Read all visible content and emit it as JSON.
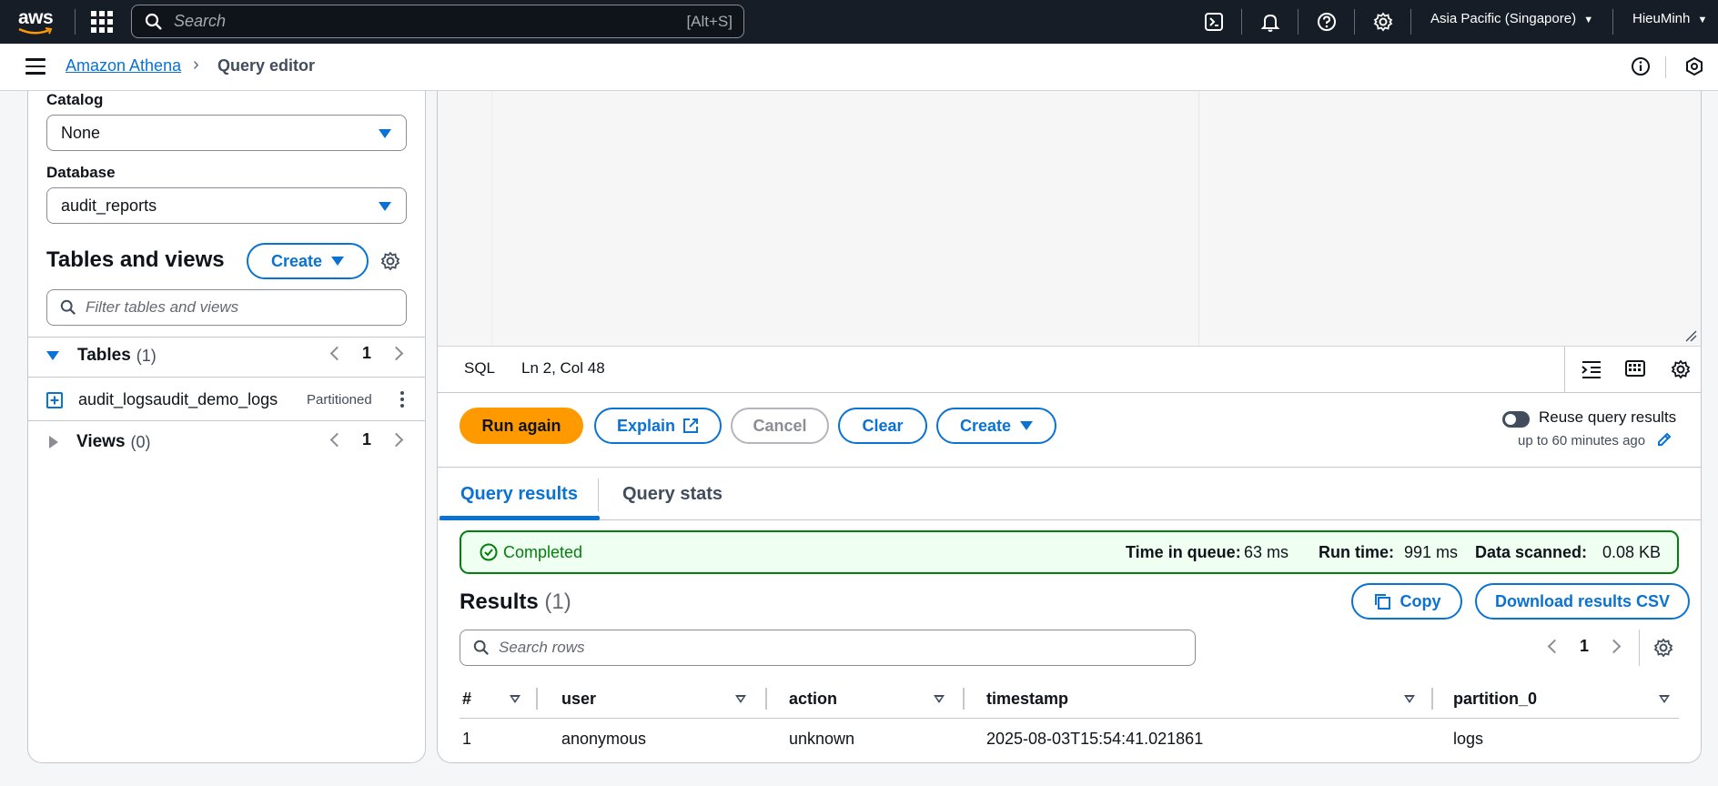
{
  "topbar": {
    "logo": "aws",
    "search_placeholder": "Search",
    "search_shortcut": "[Alt+S]",
    "region": "Asia Pacific (Singapore)",
    "user": "HieuMinh"
  },
  "breadcrumb": {
    "parent": "Amazon Athena",
    "current": "Query editor"
  },
  "left": {
    "catalog_label": "Catalog",
    "catalog_value": "None",
    "database_label": "Database",
    "database_value": "audit_reports",
    "tables_views_title": "Tables and views",
    "create_label": "Create",
    "filter_placeholder": "Filter tables and views",
    "tables": {
      "label": "Tables",
      "count": "(1)",
      "page": "1",
      "items": [
        {
          "name": "audit_logsaudit_demo_logs",
          "badge": "Partitioned"
        }
      ]
    },
    "views": {
      "label": "Views",
      "count": "(0)",
      "page": "1"
    }
  },
  "editor": {
    "language": "SQL",
    "cursor": "Ln 2, Col 48"
  },
  "actions": {
    "run_again": "Run again",
    "explain": "Explain",
    "cancel": "Cancel",
    "clear": "Clear",
    "create": "Create",
    "reuse_label": "Reuse query results",
    "reuse_sub": "up to 60 minutes ago"
  },
  "tabs": {
    "results": "Query results",
    "stats": "Query stats"
  },
  "status": {
    "state": "Completed",
    "queue_label": "Time in queue:",
    "queue_value": "63 ms",
    "run_label": "Run time:",
    "run_value": "991 ms",
    "scanned_label": "Data scanned:",
    "scanned_value": "0.08 KB"
  },
  "results": {
    "title": "Results",
    "count": "(1)",
    "copy": "Copy",
    "download": "Download results CSV",
    "search_placeholder": "Search rows",
    "page": "1",
    "columns": [
      "#",
      "user",
      "action",
      "timestamp",
      "partition_0"
    ],
    "rows": [
      [
        "1",
        "anonymous",
        "unknown",
        "2025-08-03T15:54:41.021861",
        "logs"
      ]
    ]
  },
  "colors": {
    "topbar_bg": "#161d26",
    "link_blue": "#0972d3",
    "primary_orange": "#ff9900",
    "success_green": "#037f0c"
  }
}
